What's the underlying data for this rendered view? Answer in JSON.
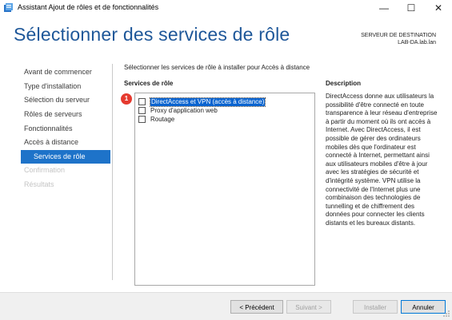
{
  "window": {
    "title": "Assistant Ajout de rôles et de fonctionnalités",
    "minimize": "—",
    "maximize": "☐",
    "close": "✕"
  },
  "header": {
    "page_title": "Sélectionner des services de rôle",
    "destination_label": "SERVEUR DE DESTINATION",
    "destination_server": "LAB-DA.lab.lan"
  },
  "nav": {
    "items": [
      {
        "label": "Avant de commencer",
        "state": "normal"
      },
      {
        "label": "Type d'installation",
        "state": "normal"
      },
      {
        "label": "Sélection du serveur",
        "state": "normal"
      },
      {
        "label": "Rôles de serveurs",
        "state": "normal"
      },
      {
        "label": "Fonctionnalités",
        "state": "normal"
      },
      {
        "label": "Accès à distance",
        "state": "normal"
      },
      {
        "label": "Services de rôle",
        "state": "active"
      },
      {
        "label": "Confirmation",
        "state": "disabled"
      },
      {
        "label": "Résultats",
        "state": "disabled"
      }
    ]
  },
  "main": {
    "intro": "Sélectionner les services de rôle à installer pour Accès à distance",
    "services_heading": "Services de rôle",
    "services": [
      {
        "label": "DirectAccess et VPN (accès à distance)",
        "checked": false,
        "selected": true
      },
      {
        "label": "Proxy d'application web",
        "checked": false,
        "selected": false
      },
      {
        "label": "Routage",
        "checked": false,
        "selected": false
      }
    ],
    "callout_number": "1",
    "description_heading": "Description",
    "description": "DirectAccess donne aux utilisateurs la possibilité d'être connecté en toute transparence à leur réseau d'entreprise à partir du moment où ils ont accès à Internet. Avec DirectAccess, il est possible de gérer des ordinateurs mobiles dès que l'ordinateur est connecté à Internet, permettant ainsi aux utilisateurs mobiles d'être à jour avec les stratégies de sécurité et d'intégrité système. VPN utilise la connectivité de l'Internet plus une combinaison des technologies de tunnelling et de chiffrement des données pour connecter les clients distants et les bureaux distants."
  },
  "footer": {
    "previous": "< Précédent",
    "next": "Suivant >",
    "install": "Installer",
    "cancel": "Annuler"
  },
  "colors": {
    "title_blue": "#1e5799",
    "nav_active": "#1e73c9",
    "selection": "#0a64d0",
    "callout": "#e53a2f"
  }
}
